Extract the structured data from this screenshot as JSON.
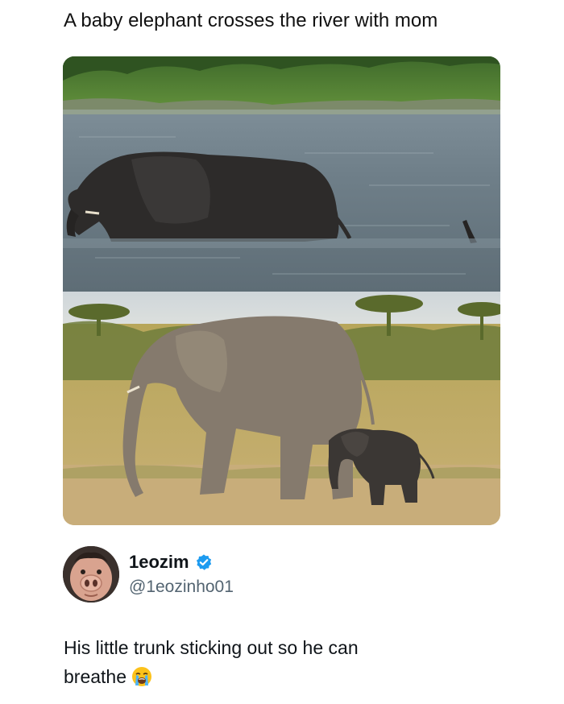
{
  "post": {
    "caption": "A baby elephant crosses the river with mom",
    "media": {
      "top_image": "elephant-and-calf-crossing-river",
      "bottom_image": "elephant-and-calf-walking-savanna"
    }
  },
  "tweet": {
    "display_name": "1eozim",
    "handle": "@1eozinho01",
    "verified": true,
    "avatar_icon": "pig-face-avatar",
    "text_line1": "His little trunk sticking out so he can",
    "text_line2": "breathe",
    "emoji_icon": "loudly-crying-face-icon"
  },
  "colors": {
    "verified_badge": "#1d9bf0",
    "handle_text": "#536471",
    "body_text": "#0f1419"
  }
}
